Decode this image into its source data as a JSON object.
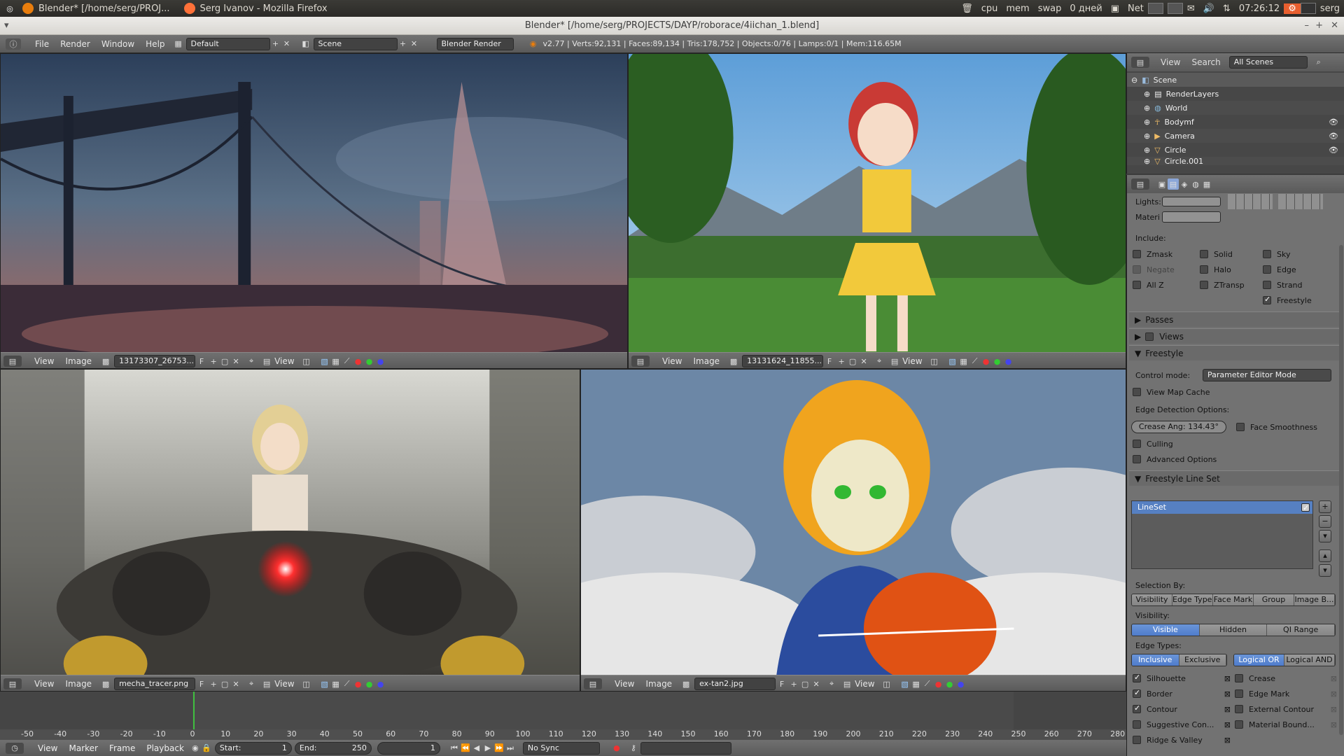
{
  "system_bar": {
    "tasks": [
      {
        "label": "Blender* [/home/serg/PROJ...",
        "color": "#e87d0d"
      },
      {
        "label": "Serg Ivanov - Mozilla Firefox",
        "color": "#ff7139"
      }
    ],
    "indicators": [
      "cpu",
      "mem",
      "swap",
      "0 дней",
      "Net"
    ],
    "time": "07:26:12",
    "user": "serg"
  },
  "window": {
    "title": "Blender* [/home/serg/PROJECTS/DAYP/roborace/4iichan_1.blend]"
  },
  "info_header": {
    "menus": [
      "File",
      "Render",
      "Window",
      "Help"
    ],
    "layout": "Default",
    "scene": "Scene",
    "engine": "Blender Render",
    "stats": "v2.77 | Verts:92,131 | Faces:89,134 | Tris:178,752 | Objects:0/76 | Lamps:0/1 | Mem:116.65M"
  },
  "viewports": [
    {
      "id": "top-left",
      "menus": [
        "View",
        "Image"
      ],
      "image": "13173307_26753...",
      "f": "F",
      "view": "View"
    },
    {
      "id": "top-right",
      "menus": [
        "View",
        "Image"
      ],
      "image": "13131624_11855...",
      "f": "F",
      "view": "View"
    },
    {
      "id": "bottom-left",
      "menus": [
        "View",
        "Image"
      ],
      "image": "mecha_tracer.png",
      "f": "F",
      "view": "View"
    },
    {
      "id": "bottom-right",
      "menus": [
        "View",
        "Image"
      ],
      "image": "ex-tan2.jpg",
      "f": "F",
      "view": "View"
    }
  ],
  "outliner": {
    "menus": [
      "View",
      "Search"
    ],
    "filter": "All Scenes",
    "rows": [
      {
        "label": "Scene",
        "indent": 0
      },
      {
        "label": "RenderLayers",
        "indent": 1
      },
      {
        "label": "World",
        "indent": 1
      },
      {
        "label": "Bodymf",
        "indent": 1
      },
      {
        "label": "Camera",
        "indent": 1
      },
      {
        "label": "Circle",
        "indent": 1
      },
      {
        "label": "Circle.001",
        "indent": 1
      }
    ]
  },
  "properties": {
    "lights_label": "Lights:",
    "materi_label": "Materi",
    "include_label": "Include:",
    "include": [
      {
        "label": "Zmask",
        "checked": false
      },
      {
        "label": "Solid",
        "checked": false
      },
      {
        "label": "Sky",
        "checked": false
      },
      {
        "label": "Negate",
        "checked": false
      },
      {
        "label": "Halo",
        "checked": false
      },
      {
        "label": "Edge",
        "checked": false
      },
      {
        "label": "All Z",
        "checked": false
      },
      {
        "label": "ZTransp",
        "checked": false
      },
      {
        "label": "Strand",
        "checked": false
      },
      {
        "label": "Freestyle",
        "checked": true
      }
    ],
    "passes": "Passes",
    "views": "Views",
    "freestyle": "Freestyle",
    "control_mode_label": "Control mode:",
    "control_mode": "Parameter Editor Mode",
    "view_map_cache": "View Map Cache",
    "edge_detection": "Edge Detection Options:",
    "crease_angle": "Crease Ang: 134.43°",
    "face_smoothness": "Face Smoothness",
    "culling": "Culling",
    "advanced": "Advanced Options",
    "lineset_header": "Freestyle Line Set",
    "lineset_item": "LineSet",
    "selection_by": "Selection By:",
    "selection_tabs": [
      "Visibility",
      "Edge Types",
      "Face Mark",
      "Group",
      "Image B..."
    ],
    "visibility_label": "Visibility:",
    "visibility_tabs": [
      "Visible",
      "Hidden",
      "QI Range"
    ],
    "edge_types_label": "Edge Types:",
    "edge_mode_a": [
      "Inclusive",
      "Exclusive"
    ],
    "edge_mode_b": [
      "Logical OR",
      "Logical AND"
    ],
    "edges_left": [
      {
        "label": "Silhouette",
        "checked": true
      },
      {
        "label": "Border",
        "checked": true
      },
      {
        "label": "Contour",
        "checked": true
      },
      {
        "label": "Suggestive Con...",
        "checked": false
      },
      {
        "label": "Ridge & Valley",
        "checked": false
      }
    ],
    "edges_right": [
      {
        "label": "Crease",
        "checked": false
      },
      {
        "label": "Edge Mark",
        "checked": false
      },
      {
        "label": "External Contour",
        "checked": false
      },
      {
        "label": "Material Bound...",
        "checked": false
      }
    ]
  },
  "timeline": {
    "ticks": [
      "-50",
      "-40",
      "-30",
      "-20",
      "-10",
      "0",
      "10",
      "20",
      "30",
      "40",
      "50",
      "60",
      "70",
      "80",
      "90",
      "100",
      "110",
      "120",
      "130",
      "140",
      "150",
      "160",
      "170",
      "180",
      "190",
      "200",
      "210",
      "220",
      "230",
      "240",
      "250",
      "260",
      "270",
      "280"
    ],
    "current_frame": 1,
    "menus": [
      "View",
      "Marker",
      "Frame",
      "Playback"
    ],
    "start": "Start:",
    "start_val": "1",
    "end": "End:",
    "end_val": "250",
    "frame": "1",
    "sync": "No Sync"
  }
}
